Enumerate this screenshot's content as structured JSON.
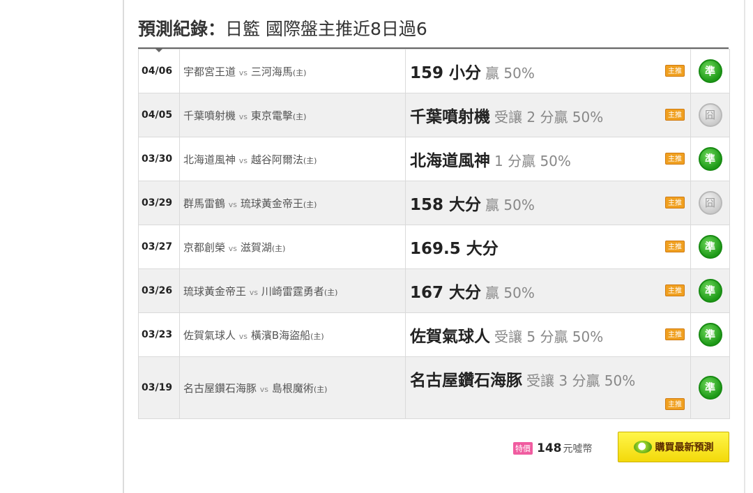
{
  "heading": {
    "label": "預測紀錄：",
    "subtitle": "日籃 國際盤主推近8日過6"
  },
  "rows": [
    {
      "date": "04/06",
      "team_a": "宇都宮王道",
      "vs": "vs",
      "team_b": "三河海馬",
      "host": "(主)",
      "pred_main": "159 小分",
      "pred_detail": "贏 50%",
      "tag": "主推",
      "result": "準",
      "result_type": "win"
    },
    {
      "date": "04/05",
      "team_a": "千葉噴射機",
      "vs": "vs",
      "team_b": "東京電擊",
      "host": "(主)",
      "pred_main": "千葉噴射機",
      "pred_detail": "受讓 2 分贏 50%",
      "tag": "主推",
      "result": "囧",
      "result_type": "push"
    },
    {
      "date": "03/30",
      "team_a": "北海道風神",
      "vs": "vs",
      "team_b": "越谷阿爾法",
      "host": "(主)",
      "pred_main": "北海道風神",
      "pred_detail": "1 分贏 50%",
      "tag": "主推",
      "result": "準",
      "result_type": "win"
    },
    {
      "date": "03/29",
      "team_a": "群馬雷鶴",
      "vs": "vs",
      "team_b": "琉球黃金帝王",
      "host": "(主)",
      "pred_main": "158 大分",
      "pred_detail": "贏 50%",
      "tag": "主推",
      "result": "囧",
      "result_type": "push"
    },
    {
      "date": "03/27",
      "team_a": "京都創榮",
      "vs": "vs",
      "team_b": "滋賀湖",
      "host": "(主)",
      "pred_main": "169.5 大分",
      "pred_detail": "",
      "tag": "主推",
      "result": "準",
      "result_type": "win"
    },
    {
      "date": "03/26",
      "team_a": "琉球黃金帝王",
      "vs": "vs",
      "team_b": "川崎雷霆勇者",
      "host": "(主)",
      "pred_main": "167 大分",
      "pred_detail": "贏 50%",
      "tag": "主推",
      "result": "準",
      "result_type": "win"
    },
    {
      "date": "03/23",
      "team_a": "佐賀氣球人",
      "vs": "vs",
      "team_b": "橫濱B海盜船",
      "host": "(主)",
      "pred_main": "佐賀氣球人",
      "pred_detail": "受讓 5 分贏 50%",
      "tag": "主推",
      "result": "準",
      "result_type": "win"
    },
    {
      "date": "03/19",
      "team_a": "名古屋鑽石海豚",
      "vs": "vs",
      "team_b": "島根魔術",
      "host": "(主)",
      "pred_main": "名古屋鑽石海豚",
      "pred_detail": "受讓 3 分贏 50%",
      "tag": "主推",
      "result": "準",
      "result_type": "win"
    }
  ],
  "purchase": {
    "sale_tag": "特價",
    "price": "148",
    "unit": "元噓幣",
    "button_label": "購買最新預測"
  },
  "colors": {
    "win_badge": "#1e9a18",
    "push_badge": "#c8c8c8",
    "tag": "#f0a020",
    "buy_button": "#f3d90a"
  }
}
